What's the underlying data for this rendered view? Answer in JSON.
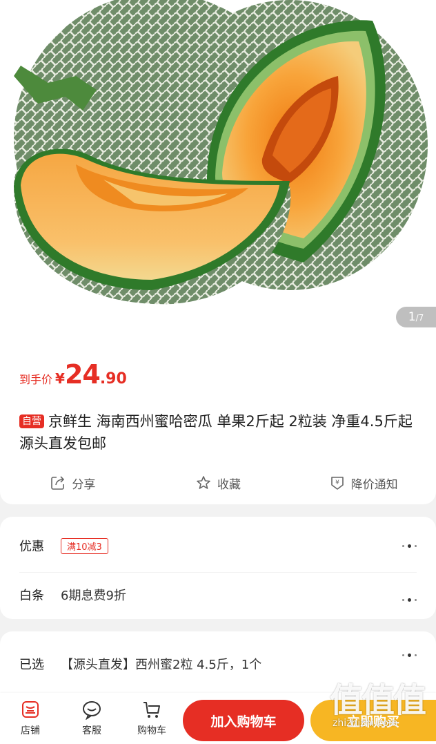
{
  "gallery": {
    "image_alt": "Hami melon product photo",
    "indicator_current": "1",
    "indicator_total": "/7"
  },
  "price": {
    "label": "到手价",
    "symbol": "¥",
    "integer": "24",
    "decimal": ".90"
  },
  "product": {
    "badge": "自营",
    "title": "京鲜生 海南西州蜜哈密瓜 单果2斤起 2粒装 净重4.5斤起 源头直发包邮"
  },
  "actions": [
    {
      "label": "分享",
      "icon": "share-icon"
    },
    {
      "label": "收藏",
      "icon": "star-icon"
    },
    {
      "label": "降价通知",
      "icon": "price-drop-icon"
    }
  ],
  "promo": {
    "label": "优惠",
    "coupon": "满10减3"
  },
  "baitiao": {
    "label": "白条",
    "text": "6期息费9折"
  },
  "selected": {
    "label": "已选",
    "text": "【源头直发】西州蜜2粒 4.5斤，1个"
  },
  "bottom_bar": {
    "tabs": [
      {
        "label": "店铺",
        "icon": "store-icon"
      },
      {
        "label": "客服",
        "icon": "customer-service-icon"
      },
      {
        "label": "购物车",
        "icon": "cart-icon"
      }
    ],
    "add_to_cart": "加入购物车",
    "buy_now": "立即购买"
  },
  "watermark": {
    "text": "值值值",
    "url": "zhizhizhi.com"
  },
  "colors": {
    "accent_red": "#e62e24",
    "buy_yellow": "#f7b623"
  }
}
